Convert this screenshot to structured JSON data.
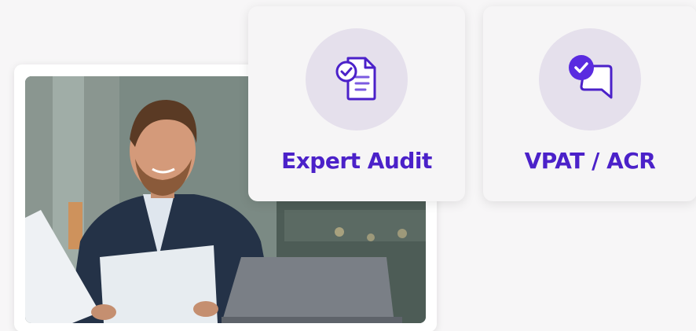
{
  "services": {
    "audit": {
      "label": "Expert Audit",
      "icon": "document-check-icon"
    },
    "vpat": {
      "label": "VPAT / ACR",
      "icon": "chat-check-icon"
    }
  },
  "photo": {
    "subject": "man-reviewing-document-photo"
  },
  "colors": {
    "accent": "#4b21c9",
    "icon_bg": "#e5e0ec",
    "card_bg": "#f6f5f6"
  }
}
